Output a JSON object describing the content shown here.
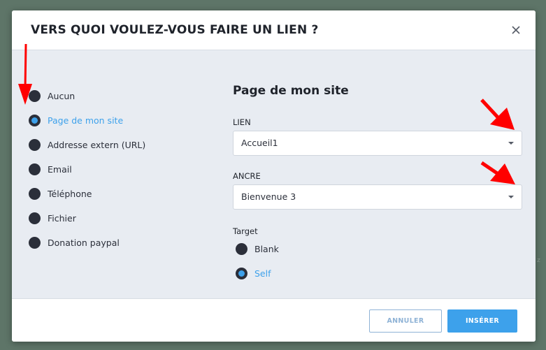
{
  "modal": {
    "title": "VERS QUOI VOULEZ-VOUS FAIRE UN LIEN ?"
  },
  "link_types": {
    "items": [
      {
        "label": "Aucun",
        "selected": false
      },
      {
        "label": "Page de mon site",
        "selected": true
      },
      {
        "label": "Addresse extern (URL)",
        "selected": false
      },
      {
        "label": "Email",
        "selected": false
      },
      {
        "label": "Téléphone",
        "selected": false
      },
      {
        "label": "Fichier",
        "selected": false
      },
      {
        "label": "Donation paypal",
        "selected": false
      }
    ]
  },
  "pane": {
    "title": "Page de mon site",
    "lien": {
      "label": "LIEN",
      "value": "Accueil1"
    },
    "ancre": {
      "label": "ANCRE",
      "value": "Bienvenue 3"
    },
    "target": {
      "label": "Target",
      "options": [
        {
          "label": "Blank",
          "selected": false
        },
        {
          "label": "Self",
          "selected": true
        }
      ]
    }
  },
  "footer": {
    "cancel_label": "ANNULER",
    "insert_label": "INSÉRER"
  },
  "colors": {
    "accent": "#3da1eb",
    "annotation_arrow": "#ff0000",
    "backdrop": "#5e7568"
  },
  "icons": {
    "close": "close-icon",
    "dropdown": "caret-down-icon",
    "annotation": "red-arrow-icon"
  },
  "background_hint": "z"
}
